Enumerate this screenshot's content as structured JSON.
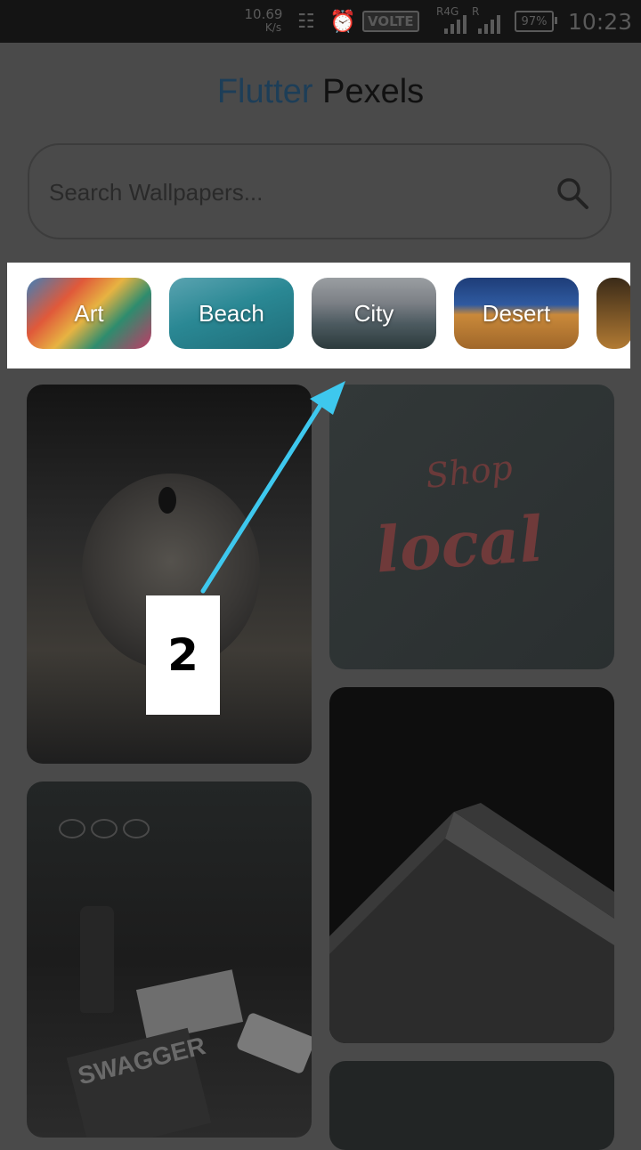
{
  "status_bar": {
    "net_speed": "10.69",
    "net_unit": "K/s",
    "volte": "VOLTE",
    "sim1_label": "R4G",
    "sim2_label": "R",
    "battery": "97%",
    "time": "10:23"
  },
  "header": {
    "title_accent": "Flutter",
    "title_rest": "Pexels"
  },
  "search": {
    "placeholder": "Search Wallpapers..."
  },
  "categories": [
    {
      "label": "Art"
    },
    {
      "label": "Beach"
    },
    {
      "label": "City"
    },
    {
      "label": "Desert"
    }
  ],
  "photo_grid": {
    "p2_text_top": "Shop",
    "p2_text_bottom": "local",
    "p4_magazine_text": "SWAGGER"
  },
  "annotation": {
    "step_number": "2",
    "highlight_color": "#ffffff",
    "arrow_color": "#3ec8ee"
  }
}
